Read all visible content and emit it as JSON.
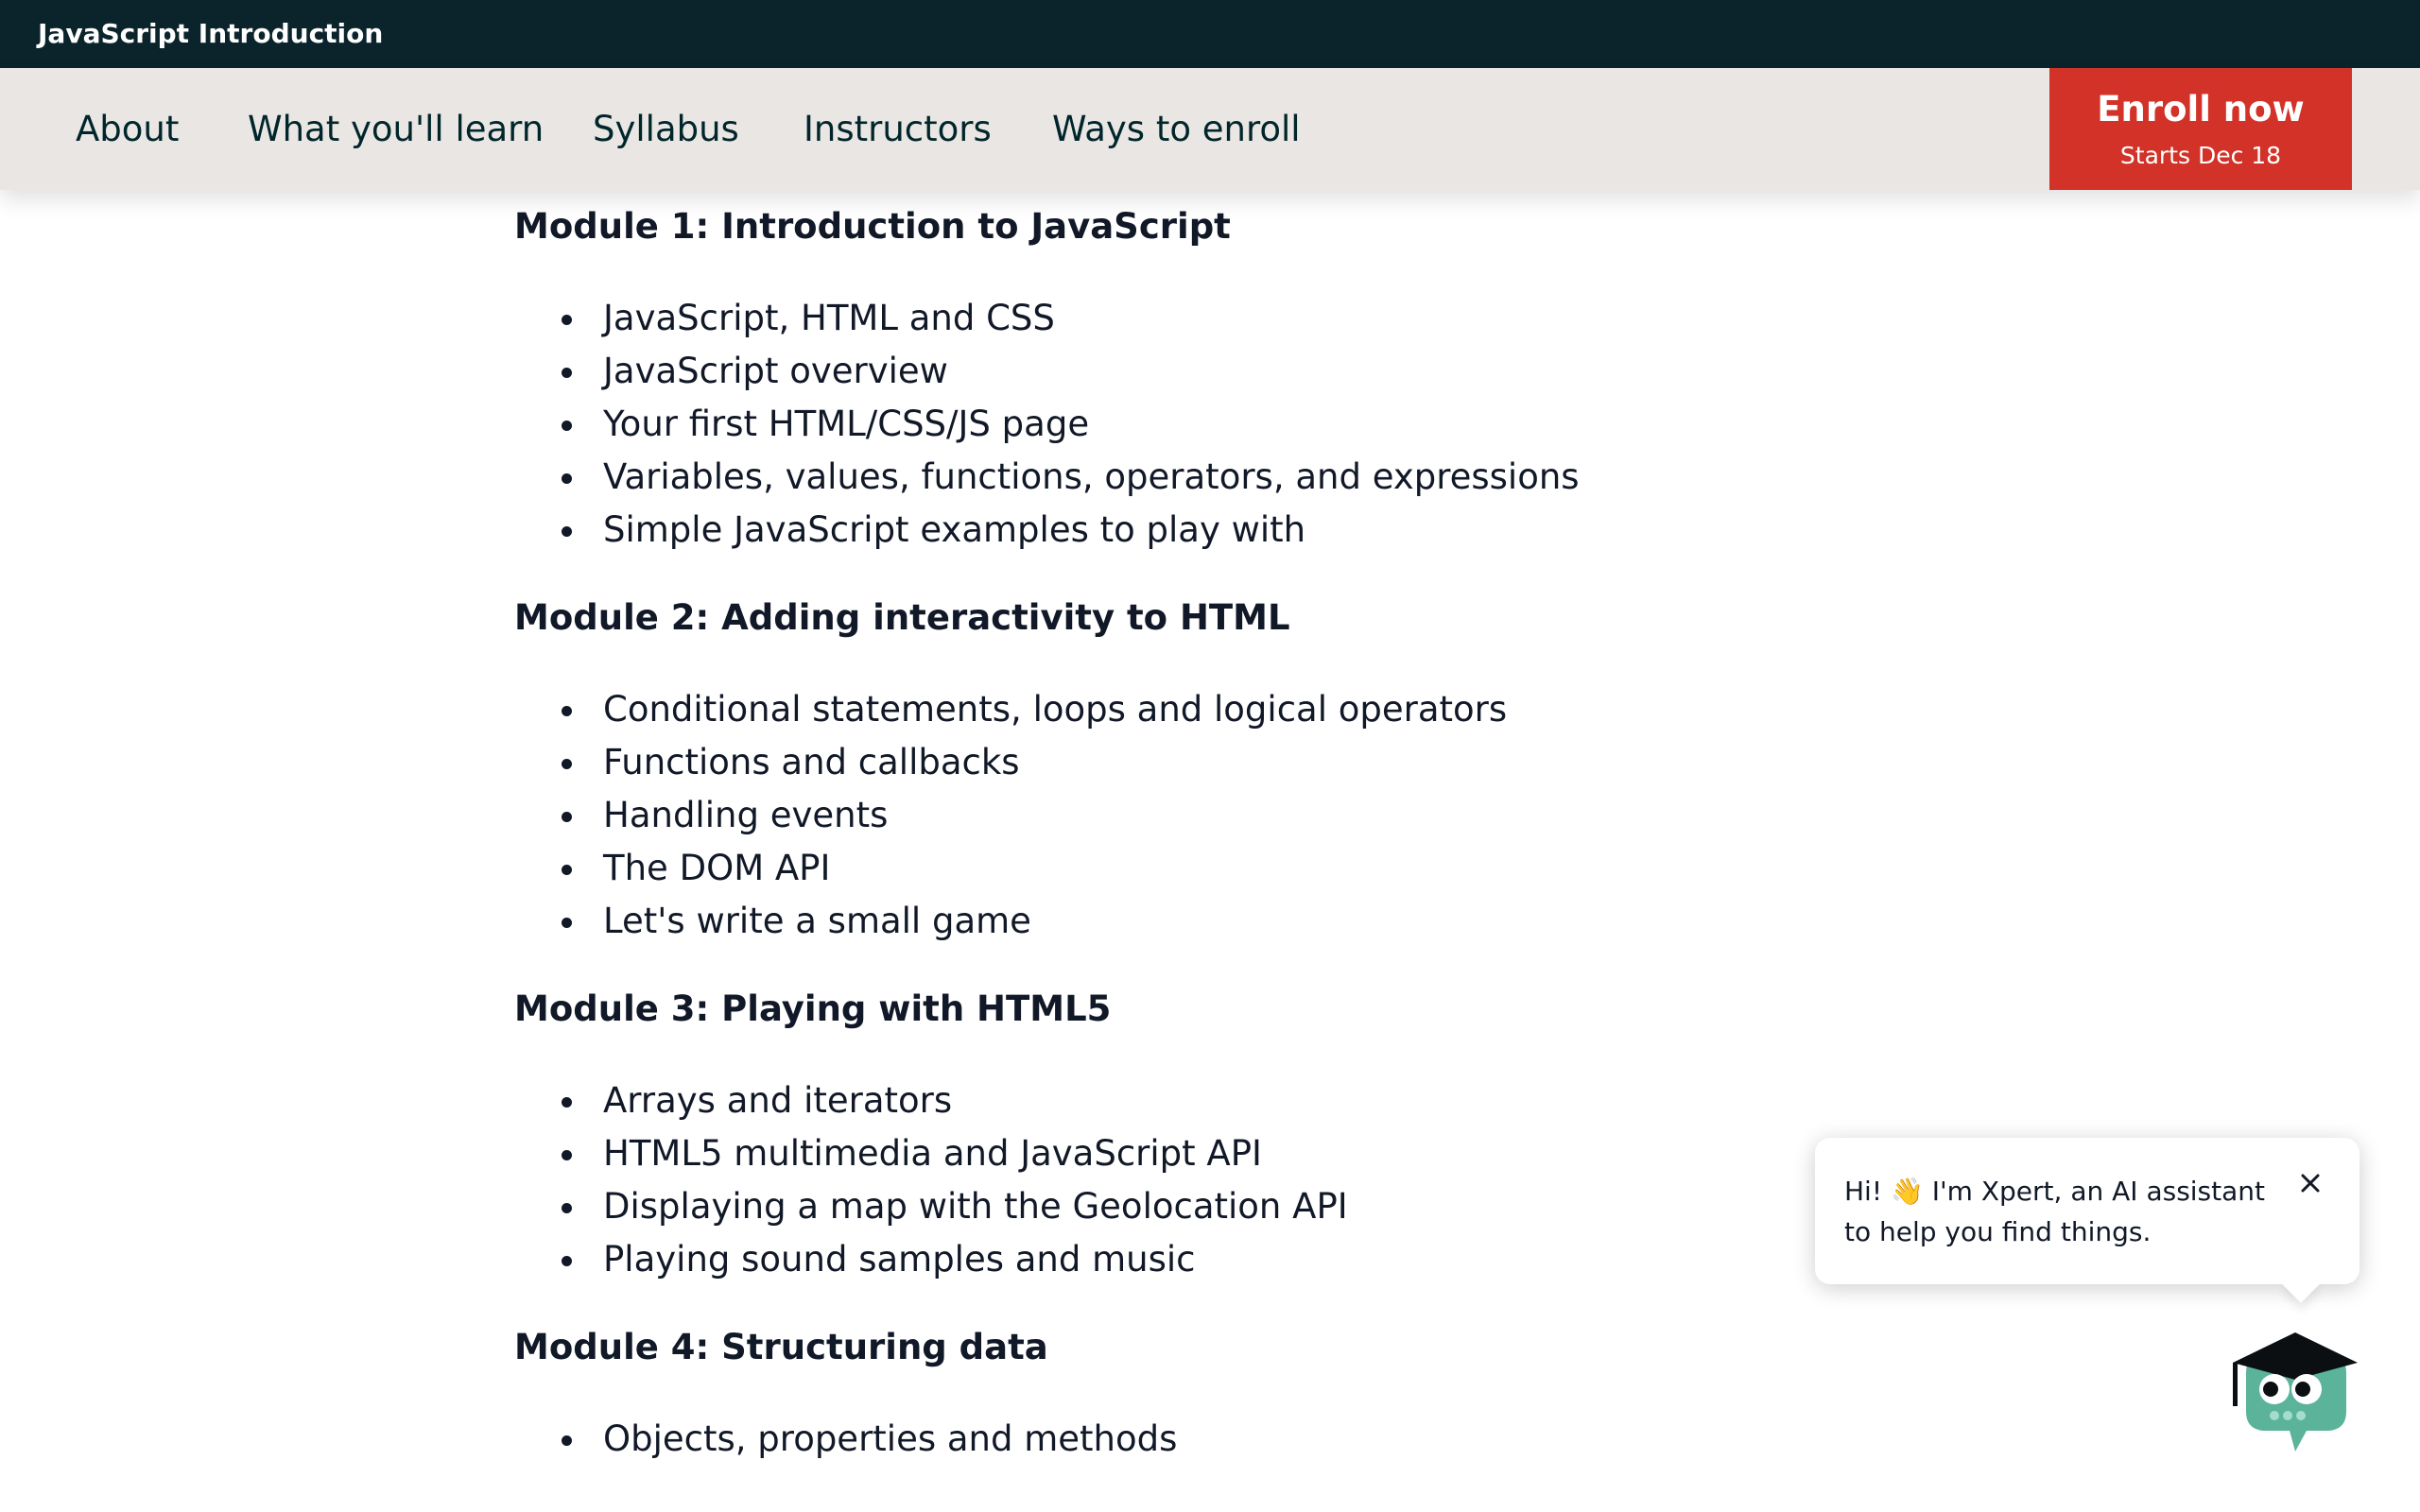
{
  "topbar": {
    "title": "JavaScript Introduction"
  },
  "nav": {
    "items": [
      {
        "label": "About"
      },
      {
        "label": "What you'll learn"
      },
      {
        "label": "Syllabus"
      },
      {
        "label": "Instructors"
      },
      {
        "label": "Ways to enroll"
      }
    ],
    "enroll": {
      "label": "Enroll now",
      "sublabel": "Starts Dec 18"
    }
  },
  "modules": [
    {
      "title": "Module 1: Introduction to JavaScript",
      "items": [
        "JavaScript, HTML and CSS",
        "JavaScript overview",
        "Your first HTML/CSS/JS page",
        "Variables, values, functions, operators, and expressions",
        "Simple JavaScript examples to play with"
      ]
    },
    {
      "title": "Module 2: Adding interactivity to HTML",
      "items": [
        "Conditional statements, loops and logical operators",
        "Functions and callbacks",
        "Handling events",
        "The DOM API",
        "Let's write a small game"
      ]
    },
    {
      "title": "Module 3: Playing with HTML5",
      "items": [
        "Arrays and iterators",
        "HTML5 multimedia and JavaScript API",
        "Displaying a map with the Geolocation API",
        "Playing sound samples and music"
      ]
    },
    {
      "title": "Module 4: Structuring data",
      "items": [
        "Objects, properties and methods"
      ]
    }
  ],
  "chat": {
    "message": "Hi! 👋 I'm Xpert, an AI assistant to help you find things.",
    "close_icon": "close-icon",
    "mascot_icon": "xpert-mascot-icon"
  },
  "colors": {
    "topbar_bg": "#0b242c",
    "nav_bg": "#eae6e4",
    "enroll_bg": "#d23228",
    "mascot_green": "#5bb49a"
  }
}
